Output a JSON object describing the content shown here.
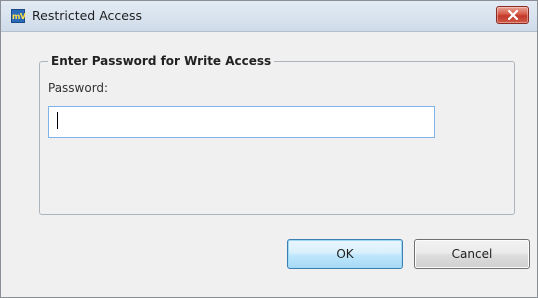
{
  "window": {
    "title": "Restricted Access",
    "app_icon_text": "mV"
  },
  "group": {
    "title": "Enter Password for Write Access"
  },
  "password": {
    "label": "Password:",
    "value": ""
  },
  "buttons": {
    "ok": "OK",
    "cancel": "Cancel"
  },
  "colors": {
    "close_button": "#c7392a",
    "ok_button_border": "#3c7fb1",
    "input_focus_border": "#7eb4ea"
  }
}
